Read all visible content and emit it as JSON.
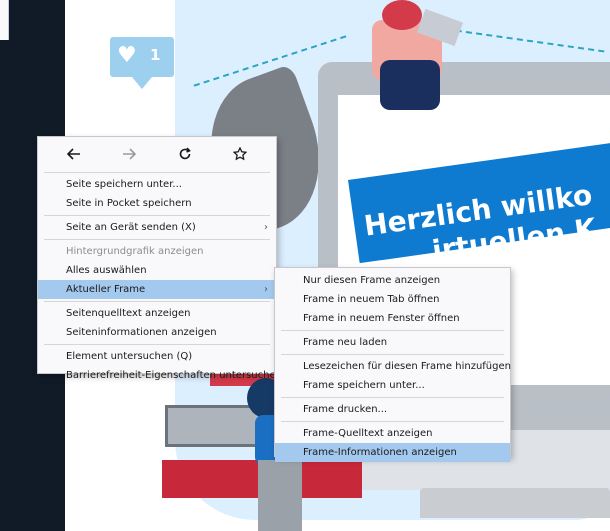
{
  "background": {
    "like_count": "1",
    "banner_line1": "Herzlich willko",
    "banner_line2": "irtuellen K"
  },
  "nav": {
    "back_icon": "arrow-left-icon",
    "forward_icon": "arrow-right-icon",
    "reload_icon": "reload-icon",
    "bookmark_icon": "star-icon"
  },
  "context_menu": {
    "items": [
      {
        "label": "Seite speichern unter..."
      },
      {
        "label": "Seite in Pocket speichern"
      },
      {
        "label": "Seite an Gerät senden (X)"
      },
      {
        "label": "Hintergrundgrafik anzeigen"
      },
      {
        "label": "Alles auswählen"
      },
      {
        "label": "Aktueller Frame"
      },
      {
        "label": "Seitenquelltext anzeigen"
      },
      {
        "label": "Seiteninformationen anzeigen"
      },
      {
        "label": "Element untersuchen (Q)"
      },
      {
        "label": "Barrierefreiheit-Eigenschaften untersuchen"
      }
    ]
  },
  "frame_submenu": {
    "items": [
      {
        "label": "Nur diesen Frame anzeigen"
      },
      {
        "label": "Frame in neuem Tab öffnen"
      },
      {
        "label": "Frame in neuem Fenster öffnen"
      },
      {
        "label": "Frame neu laden"
      },
      {
        "label": "Lesezeichen für diesen Frame hinzufügen"
      },
      {
        "label": "Frame speichern unter..."
      },
      {
        "label": "Frame drucken..."
      },
      {
        "label": "Frame-Quelltext anzeigen"
      },
      {
        "label": "Frame-Informationen anzeigen"
      }
    ]
  },
  "colors": {
    "highlight": "#a4c9ee",
    "banner_blue": "#0e7bd1",
    "dark_sidebar": "#111b27"
  }
}
